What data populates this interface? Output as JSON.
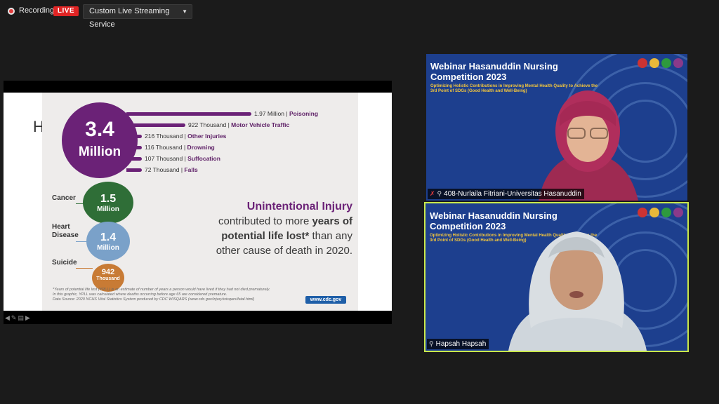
{
  "topbar": {
    "recording_label": "Recording",
    "live_label": "LIVE",
    "stream_service": "Custom Live Streaming Service",
    "stream_icon": "chevron-down-icon"
  },
  "shared_screen": {
    "slide_letter": "H",
    "infographic": {
      "total": {
        "value": "3.4",
        "unit": "Million"
      },
      "breakdown": [
        {
          "value": "1.97 Million",
          "label": "Poisoning",
          "share": 1.0
        },
        {
          "value": "922 Thousand",
          "label": "Motor Vehicle Traffic",
          "share": 0.47
        },
        {
          "value": "216 Thousand",
          "label": "Other Injuries",
          "share": 0.11
        },
        {
          "value": "116 Thousand",
          "label": "Drowning",
          "share": 0.06
        },
        {
          "value": "107 Thousand",
          "label": "Suffocation",
          "share": 0.054
        },
        {
          "value": "72 Thousand",
          "label": "Falls",
          "share": 0.037
        }
      ],
      "other_causes": [
        {
          "cause": "Cancer",
          "value": "1.5",
          "unit": "Million",
          "color": "#2f6e37"
        },
        {
          "cause": "Heart Disease",
          "value": "1.4",
          "unit": "Million",
          "color": "#7aa1c9"
        },
        {
          "cause": "Suicide",
          "value": "942",
          "unit": "Thousand",
          "color": "#c87b35"
        }
      ],
      "headline": {
        "title": "Unintentional Injury",
        "line1_pre": "contributed to more ",
        "line1_bold": "years of",
        "line2_bold": "potential life lost*",
        "line2_post": " than any",
        "line3": "other cause of death in 2020."
      },
      "footnote_1": "*Years of potential life lost (YPLL) is an estimate of number of years a person would have lived if they had not died prematurely.",
      "footnote_2": "In this graphic, YPLL was calculated where deaths occurring before age 65 are considered premature.",
      "footnote_3": "Data Source: 2020 NCHS Vital Statistics System produced by CDC WISQARS (www.cdc.gov/injury/wisqars/fatal.html)",
      "source_badge": "www.cdc.gov",
      "brand_color": "#6b2277"
    }
  },
  "participants": [
    {
      "name": "408-Nurlaila Fitriani-Universitas Hasanuddin",
      "muted": true,
      "active_speaker": false,
      "background_title": "Webinar Hasanuddin Nursing Competition 2023",
      "background_subtitle": "Optimizing Holistic Contributions in Improving Mental Health Quality to Achieve the 3rd Point of SDGs (Good Health and Well-Being)"
    },
    {
      "name": "Hapsah Hapsah",
      "muted": false,
      "active_speaker": true,
      "background_title": "Webinar Hasanuddin Nursing Competition 2023",
      "background_subtitle": "Optimizing Holistic Contributions in Improving Mental Health Quality to Achieve the 3rd Point of SDGs (Good Health and Well-Being)"
    }
  ]
}
